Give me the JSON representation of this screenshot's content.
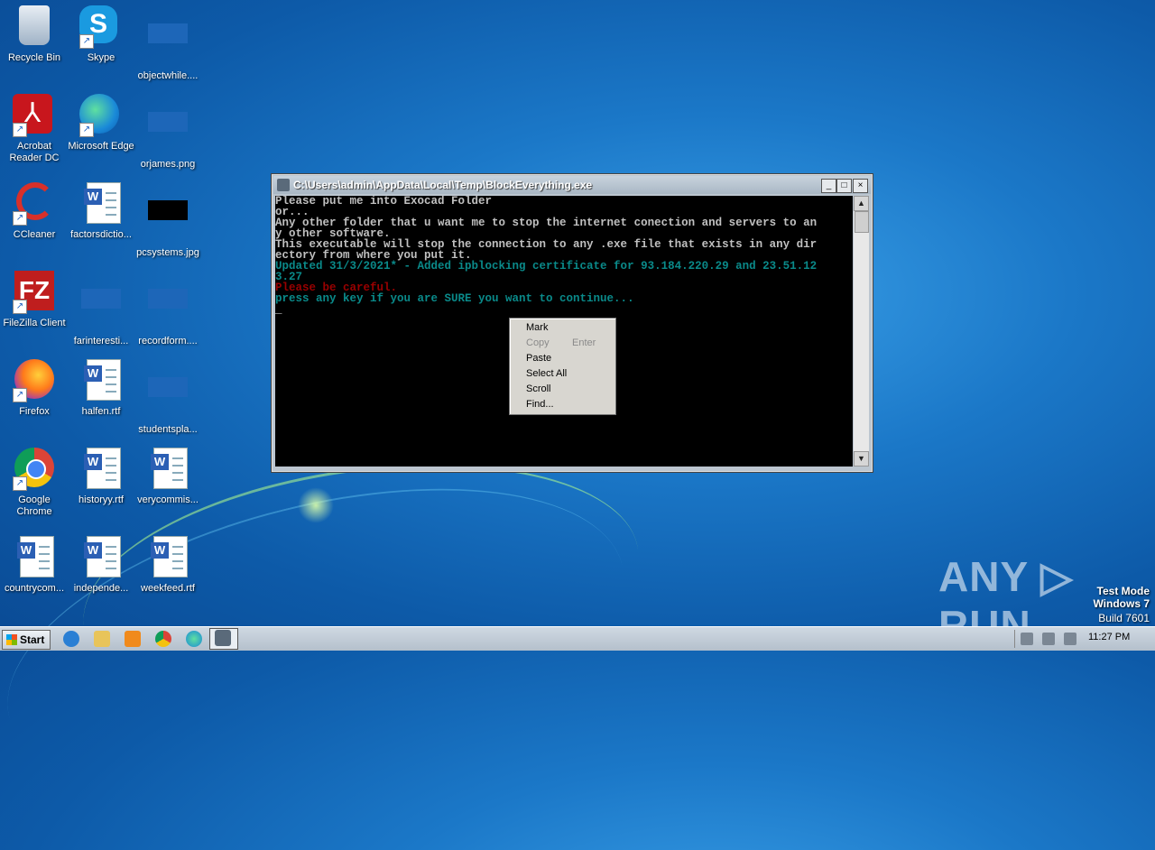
{
  "desktop": {
    "icons": [
      {
        "label": "Recycle Bin"
      },
      {
        "label": "Skype",
        "glyph": "S"
      },
      {
        "label": "objectwhile...."
      },
      {
        "label": "Acrobat Reader DC"
      },
      {
        "label": "Microsoft Edge"
      },
      {
        "label": "orjames.png"
      },
      {
        "label": "CCleaner"
      },
      {
        "label": "factorsdictio..."
      },
      {
        "label": "pcsystems.jpg"
      },
      {
        "label": "FileZilla Client",
        "glyph": "FZ"
      },
      {
        "label": "farinteresti..."
      },
      {
        "label": "recordform...."
      },
      {
        "label": "Firefox"
      },
      {
        "label": "halfen.rtf"
      },
      {
        "label": "studentspla..."
      },
      {
        "label": "Google Chrome"
      },
      {
        "label": "historyy.rtf"
      },
      {
        "label": "verycommis..."
      },
      {
        "label": "countrycom..."
      },
      {
        "label": "independe..."
      },
      {
        "label": "weekfeed.rtf"
      }
    ]
  },
  "console": {
    "title": "C:\\Users\\admin\\AppData\\Local\\Temp\\BlockEverything.exe",
    "lines": [
      {
        "text": "Please put me into Exocad Folder",
        "color": "w"
      },
      {
        "text": "or...",
        "color": "w"
      },
      {
        "text": "Any other folder that u want me to stop the internet conection and servers to an",
        "color": "w"
      },
      {
        "text": "y other software.",
        "color": "w"
      },
      {
        "text": "This executable will stop the connection to any .exe file that exists in any dir",
        "color": "w"
      },
      {
        "text": "ectory from where you put it.",
        "color": "w"
      },
      {
        "text": "Updated 31/3/2021* - Added ipblocking certificate for 93.184.220.29 and 23.51.12",
        "color": "c"
      },
      {
        "text": "3.27",
        "color": "c"
      },
      {
        "text": "Please be careful.",
        "color": "r"
      },
      {
        "text": "",
        "color": "w"
      },
      {
        "text": "",
        "color": "w"
      },
      {
        "text": "",
        "color": "w"
      },
      {
        "text": "",
        "color": "w"
      },
      {
        "text": "press any key if you are SURE you want to continue...",
        "color": "c"
      },
      {
        "text": "",
        "color": "w"
      },
      {
        "text": "_",
        "color": "w"
      }
    ],
    "buttons": {
      "minimize": "_",
      "maximize": "□",
      "close": "×"
    }
  },
  "context_menu": {
    "items": [
      {
        "label": "Mark",
        "enabled": true
      },
      {
        "label": "Copy",
        "shortcut": "Enter",
        "enabled": false
      },
      {
        "label": "Paste",
        "enabled": true
      },
      {
        "label": "Select All",
        "enabled": true
      },
      {
        "label": "Scroll",
        "enabled": true
      },
      {
        "label": "Find...",
        "enabled": true
      }
    ]
  },
  "watermark": {
    "text": "ANY ▷ RUN"
  },
  "system_info": {
    "line1": "Test Mode",
    "line2": "Windows 7",
    "line3": "Build 7601"
  },
  "taskbar": {
    "start_label": "Start",
    "clock": "11:27 PM"
  },
  "colors": {
    "console_text": "#c0c0c0",
    "console_cyan": "#0a8a8a",
    "console_red": "#9a0000",
    "desktop": "#1b78c8"
  }
}
